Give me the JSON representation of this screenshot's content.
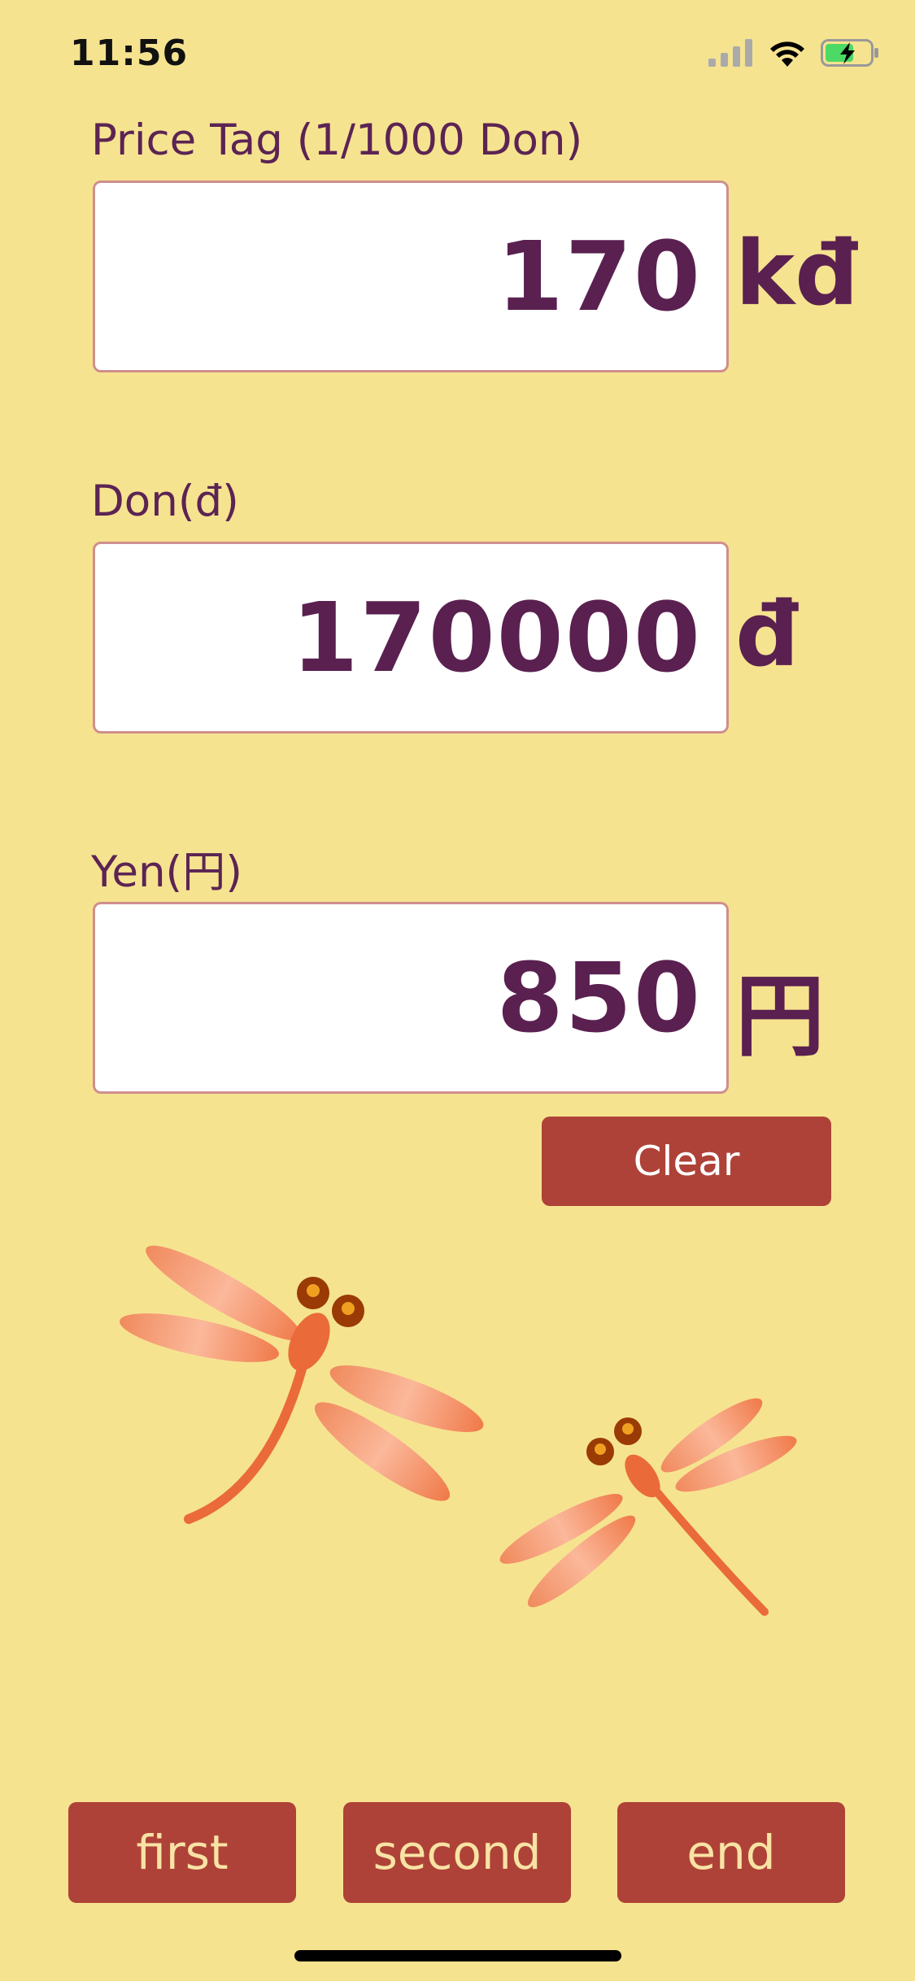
{
  "status_bar": {
    "time": "11:56",
    "icons": [
      "cellular-signal-icon",
      "wifi-icon",
      "battery-charging-icon"
    ]
  },
  "fields": [
    {
      "label": "Price Tag (1/1000 Don)",
      "value": "170",
      "unit": "kđ"
    },
    {
      "label": "Don(đ)",
      "value": "170000",
      "unit": "đ"
    },
    {
      "label": "Yen(円)",
      "value": "850",
      "unit": "円"
    }
  ],
  "clear_label": "Clear",
  "illustration": "dragonflies",
  "tabs": [
    {
      "label": "first"
    },
    {
      "label": "second"
    },
    {
      "label": "end"
    }
  ],
  "colors": {
    "background": "#f6e390",
    "text": "#5a2050",
    "button": "#ae4238",
    "button_text_light": "#f8e3a4"
  }
}
